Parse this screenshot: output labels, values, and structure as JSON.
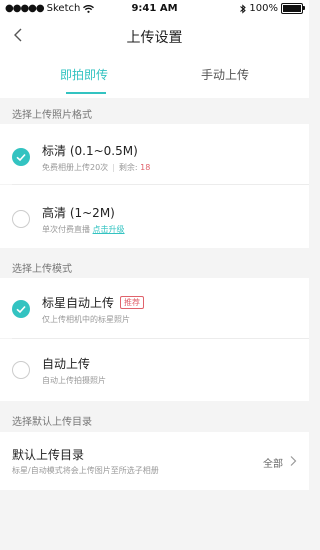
{
  "status_bar": {
    "carrier": "Sketch",
    "time": "9:41 AM",
    "battery_percent": "100%"
  },
  "nav": {
    "title": "上传设置"
  },
  "tabs": [
    {
      "label": "即拍即传",
      "active": true
    },
    {
      "label": "手动上传",
      "active": false
    }
  ],
  "sections": {
    "format": {
      "header": "选择上传照片格式",
      "standard": {
        "title": "标清 (0.1~0.5M)",
        "desc": "免费相册上传20次",
        "remaining_label": "剩余: ",
        "remaining_value": "18",
        "checked": true
      },
      "hd": {
        "title": "高清 (1~2M)",
        "desc": "单次付费直播",
        "link": "点击升级",
        "checked": false
      }
    },
    "mode": {
      "header": "选择上传模式",
      "starred": {
        "title": "标星自动上传",
        "badge": "推荐",
        "desc": "仅上传相机中的标星照片",
        "checked": true
      },
      "auto": {
        "title": "自动上传",
        "desc": "自动上传拍摄照片",
        "checked": false
      }
    },
    "directory": {
      "header": "选择默认上传目录",
      "title": "默认上传目录",
      "desc": "标星/自动模式将会上传图片至所选子相册",
      "value": "全部"
    }
  },
  "colors": {
    "accent": "#33c3c1",
    "alert": "#e0626b"
  }
}
